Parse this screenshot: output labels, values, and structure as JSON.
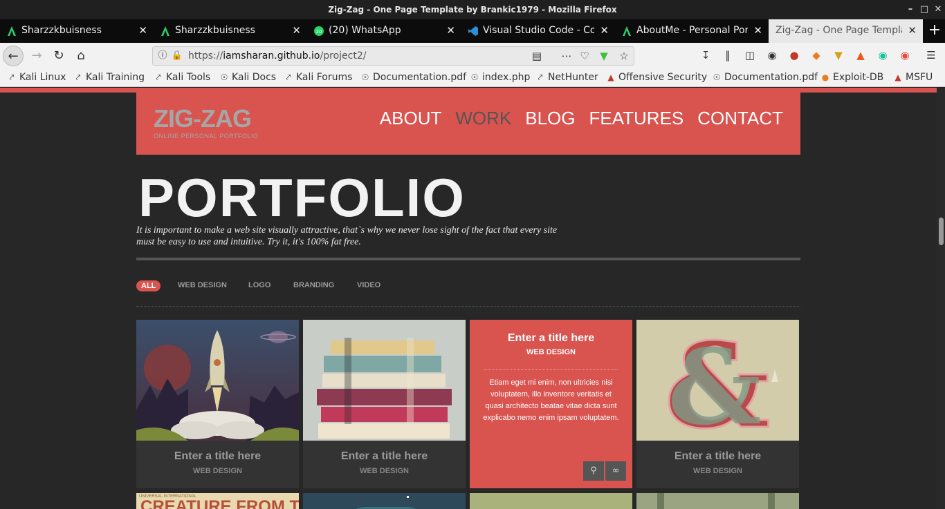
{
  "window": {
    "title": "Zig-Zag - One Page Template by Brankic1979 - Mozilla Firefox"
  },
  "tabs": [
    {
      "label": "Sharzzkbuisness",
      "icon": "app-a-icon"
    },
    {
      "label": "Sharzzkbuisness",
      "icon": "app-a-icon"
    },
    {
      "label": "(20) WhatsApp",
      "icon": "whatsapp-icon",
      "badge": "20"
    },
    {
      "label": "Visual Studio Code - Cod",
      "icon": "vscode-icon"
    },
    {
      "label": "AboutMe - Personal Port",
      "icon": "app-a-icon"
    },
    {
      "label": "Zig-Zag - One Page Templa",
      "icon": "none",
      "active": true
    }
  ],
  "url": {
    "prefix": "https://",
    "host": "iamsharan.github.io",
    "path": "/project2/"
  },
  "bookmarks": [
    "Kali Linux",
    "Kali Training",
    "Kali Tools",
    "Kali Docs",
    "Kali Forums",
    "Documentation.pdf",
    "index.php",
    "NetHunter",
    "Offensive Security",
    "Documentation.pdf",
    "Exploit-DB",
    "MSFU"
  ],
  "site": {
    "logo_big": "ZIG-ZAG",
    "logo_small": "ONLINE PERSONAL PORTFOLIO",
    "menu": [
      "ABOUT",
      "WORK",
      "BLOG",
      "FEATURES",
      "CONTACT"
    ],
    "menu_current": "WORK",
    "heading": "PORTFOLIO",
    "description": "It is important to make a web site visually attractive, that`s why we never lose sight of the fact that every site must be easy to use and intuitive. Try it, it's 100% fat free.",
    "filters": [
      "ALL",
      "WEB DESIGN",
      "LOGO",
      "BRANDING",
      "VIDEO"
    ],
    "filter_active": "ALL",
    "cards": [
      {
        "title": "Enter a title here",
        "category": "WEB DESIGN"
      },
      {
        "title": "Enter a title here",
        "category": "WEB DESIGN"
      },
      {
        "title": "Enter a title here",
        "category": "WEB DESIGN",
        "text": "Etiam eget mi enim, non ultricies nisi voluptatem, illo inventore veritatis et quasi architecto beatae vitae dicta sunt explicabo nemo enim ipsam voluptatem."
      },
      {
        "title": "Enter a title here",
        "category": "WEB DESIGN"
      }
    ],
    "row2_thumb1_text": "CREATURE FROM THE",
    "row2_thumb1_small": "UNIVERSAL INTERNATIONAL"
  },
  "colors": {
    "accent": "#d9534f",
    "page_bg": "#272727"
  }
}
